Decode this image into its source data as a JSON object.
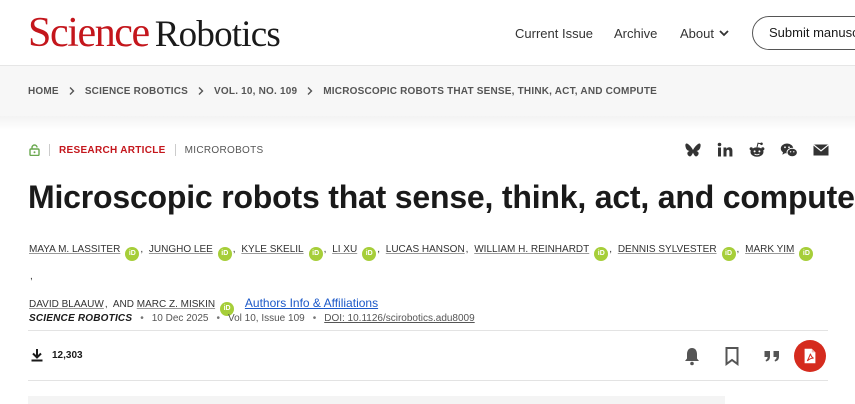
{
  "header": {
    "logo": {
      "science": "Science",
      "robotics": "Robotics"
    },
    "nav": {
      "current_issue": "Current Issue",
      "archive": "Archive",
      "about": "About"
    },
    "submit_label": "Submit manuscript"
  },
  "breadcrumb": [
    "HOME",
    "SCIENCE ROBOTICS",
    "VOL. 10, NO. 109",
    "MICROSCOPIC ROBOTS THAT SENSE, THINK, ACT, AND COMPUTE"
  ],
  "article": {
    "type": "RESEARCH ARTICLE",
    "subject": "MICROROBOTS",
    "title": "Microscopic robots that sense, think, act, and compute",
    "authors": [
      "MAYA M. LASSITER",
      "JUNGHO LEE",
      "KYLE SKELIL",
      "LI XU",
      "LUCAS HANSON",
      "WILLIAM H. REINHARDT",
      "DENNIS SYLVESTER",
      "MARK YIM",
      "DAVID BLAAUW",
      "MARC Z. MISKIN"
    ],
    "and_text": "AND",
    "orcid_label": "iD",
    "affiliations_link": "Authors Info & Affiliations",
    "journal": "SCIENCE ROBOTICS",
    "date": "10 Dec 2025",
    "volume": "Vol 10, Issue 109",
    "doi": "DOI: 10.1126/scirobotics.adu8009",
    "downloads": "12,303"
  },
  "share_icons": [
    "bluesky-icon",
    "linkedin-icon",
    "reddit-icon",
    "wechat-icon",
    "email-icon"
  ],
  "action_icons": [
    "alert-bell-icon",
    "bookmark-icon",
    "cite-icon",
    "pdf-icon"
  ],
  "colors": {
    "brand_red": "#c4161c",
    "orcid_green": "#a6ce39",
    "link_blue": "#1c59c9",
    "pdf_red": "#d52b1e"
  }
}
